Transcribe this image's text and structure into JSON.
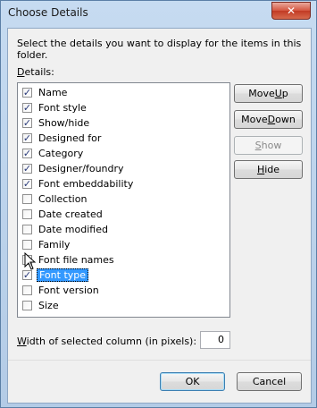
{
  "window": {
    "title": "Choose Details",
    "close_glyph": "✕"
  },
  "instruction": "Select the details you want to display for the items in this folder.",
  "details_label": {
    "accel": "D",
    "rest": "etails:"
  },
  "items": [
    {
      "label": "Name",
      "checked": true
    },
    {
      "label": "Font style",
      "checked": true
    },
    {
      "label": "Show/hide",
      "checked": true
    },
    {
      "label": "Designed for",
      "checked": true
    },
    {
      "label": "Category",
      "checked": true
    },
    {
      "label": "Designer/foundry",
      "checked": true
    },
    {
      "label": "Font embeddability",
      "checked": true
    },
    {
      "label": "Collection",
      "checked": false
    },
    {
      "label": "Date created",
      "checked": false
    },
    {
      "label": "Date modified",
      "checked": false
    },
    {
      "label": "Family",
      "checked": false
    },
    {
      "label": "Font file names",
      "checked": false
    },
    {
      "label": "Font type",
      "checked": true,
      "selected": true
    },
    {
      "label": "Font version",
      "checked": false
    },
    {
      "label": "Size",
      "checked": false
    }
  ],
  "buttons": {
    "move_up": {
      "accel": "Move ",
      "key": "U",
      "rest": "p"
    },
    "move_down": {
      "accel": "Move ",
      "key": "D",
      "rest": "own"
    },
    "show": {
      "key": "S",
      "rest": "how"
    },
    "hide": {
      "key": "H",
      "rest": "ide"
    },
    "ok": "OK",
    "cancel": "Cancel"
  },
  "width": {
    "label_key": "W",
    "label_rest": "idth of selected column (in pixels):",
    "value": "0"
  },
  "colors": {
    "selection": "#3399ff",
    "window_frame": "#b9d1ea"
  },
  "icons": {
    "close": "close-icon",
    "pointer": "mouse-pointer-icon"
  }
}
